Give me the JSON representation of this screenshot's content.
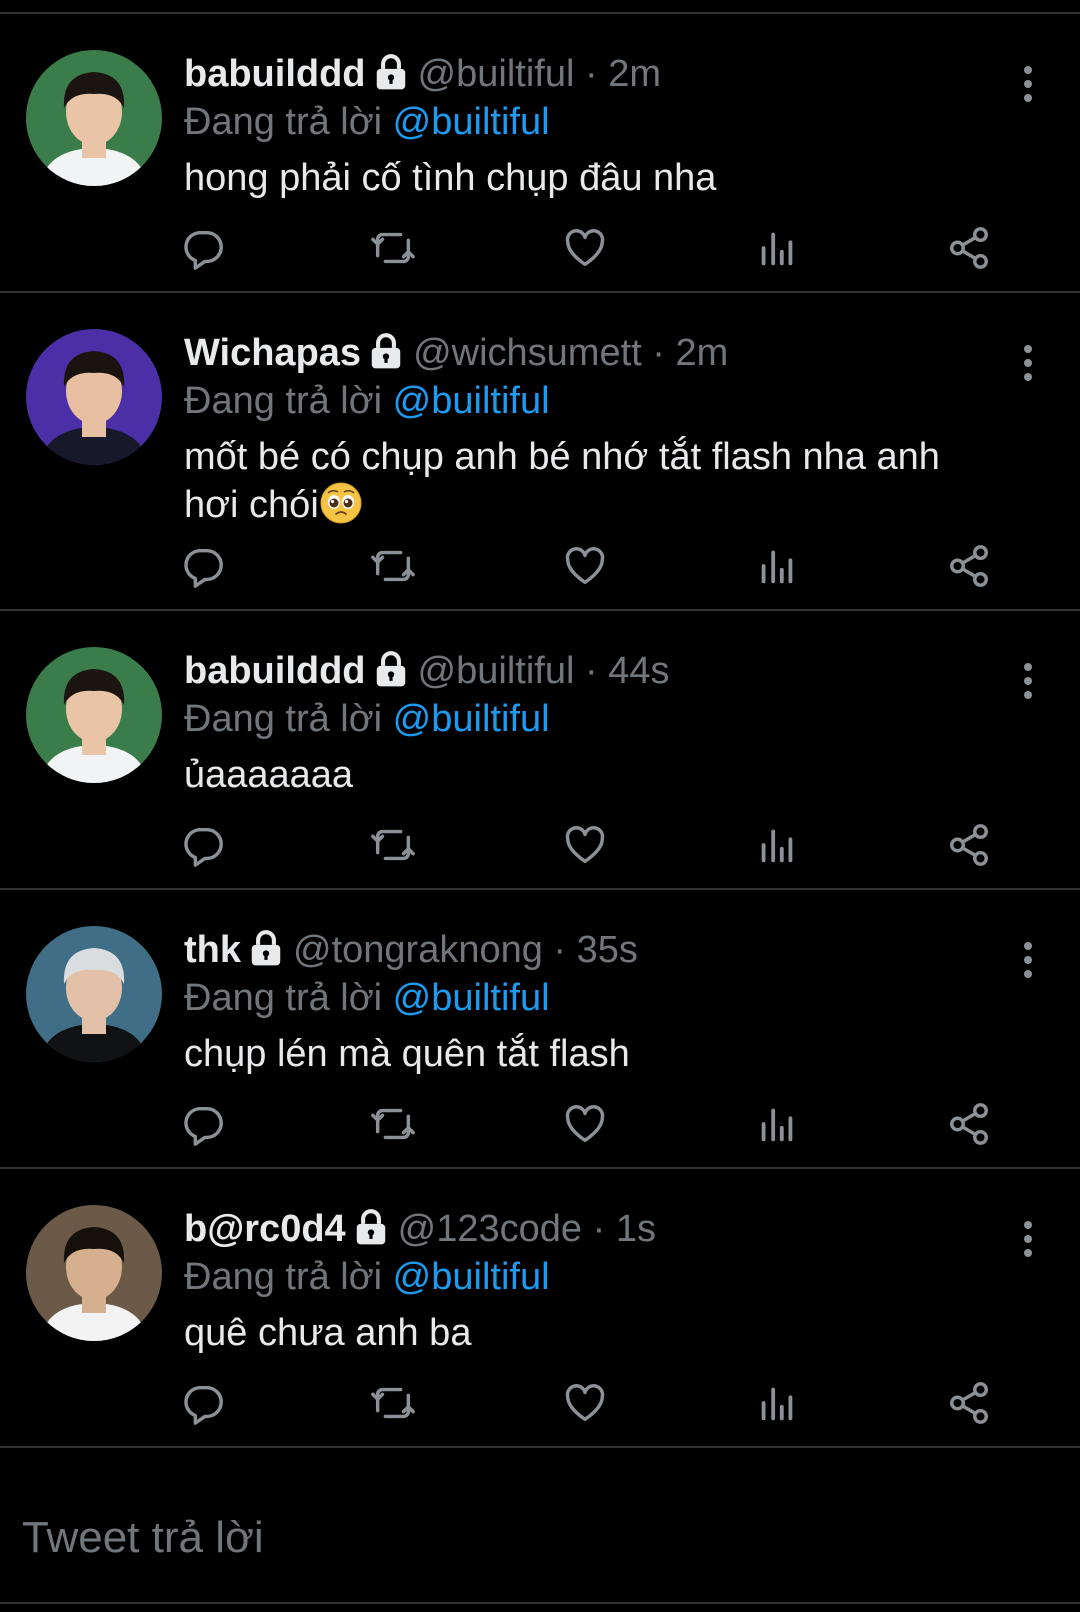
{
  "tweets": [
    {
      "display_name": "babuilddd",
      "handle": "@builtiful",
      "dot": "·",
      "time": "2m",
      "reply_prefix": "Đang trả lời",
      "reply_target": "@builtiful",
      "text": "hong phải cố tình chụp đâu nha",
      "locked": true,
      "avatar": {
        "bg": "#3b7d4a",
        "face": "#e9c4a6",
        "hair": "#1b1410",
        "shirt": "#f1f3f5"
      }
    },
    {
      "display_name": "Wichapas",
      "handle": "@wichsumett",
      "dot": "·",
      "time": "2m",
      "reply_prefix": "Đang trả lời",
      "reply_target": "@builtiful",
      "text": "mốt bé có chụp anh bé nhớ tắt flash nha anh hơi chói",
      "emoji": "pleading-face",
      "locked": true,
      "avatar": {
        "bg": "#4b2fa6",
        "face": "#e8bfa2",
        "hair": "#1a1410",
        "shirt": "#17182a"
      }
    },
    {
      "display_name": "babuilddd",
      "handle": "@builtiful",
      "dot": "·",
      "time": "44s",
      "reply_prefix": "Đang trả lời",
      "reply_target": "@builtiful",
      "text": "ủaaaaaaa",
      "locked": true,
      "avatar": {
        "bg": "#3b7d4a",
        "face": "#e9c4a6",
        "hair": "#1b1410",
        "shirt": "#f1f3f5"
      }
    },
    {
      "display_name": "thk",
      "handle": "@tongraknong",
      "dot": "·",
      "time": "35s",
      "reply_prefix": "Đang trả lời",
      "reply_target": "@builtiful",
      "text": "chụp lén mà quên tắt flash",
      "locked": true,
      "avatar": {
        "bg": "#3f6e86",
        "face": "#e2c1a8",
        "hair": "#d9dde0",
        "shirt": "#111214"
      }
    },
    {
      "display_name": "b@rc0d4",
      "handle": "@123code",
      "dot": "·",
      "time": "1s",
      "reply_prefix": "Đang trả lời",
      "reply_target": "@builtiful",
      "text": "quê chưa anh ba",
      "locked": true,
      "avatar": {
        "bg": "#6b5a47",
        "face": "#d6b08e",
        "hair": "#16100c",
        "shirt": "#f3f3f3"
      }
    }
  ],
  "reply_box": {
    "placeholder": "Tweet trả lời"
  },
  "icons": {
    "reply": "reply-icon",
    "retweet": "retweet-icon",
    "like": "heart-icon",
    "analytics": "analytics-icon",
    "share": "share-icon",
    "more": "more-vertical-icon",
    "lock": "lock-icon"
  },
  "colors": {
    "background": "#000000",
    "text": "#e7e9ea",
    "muted": "#71767b",
    "link": "#1d9bf0",
    "divider": "#2f3336"
  }
}
